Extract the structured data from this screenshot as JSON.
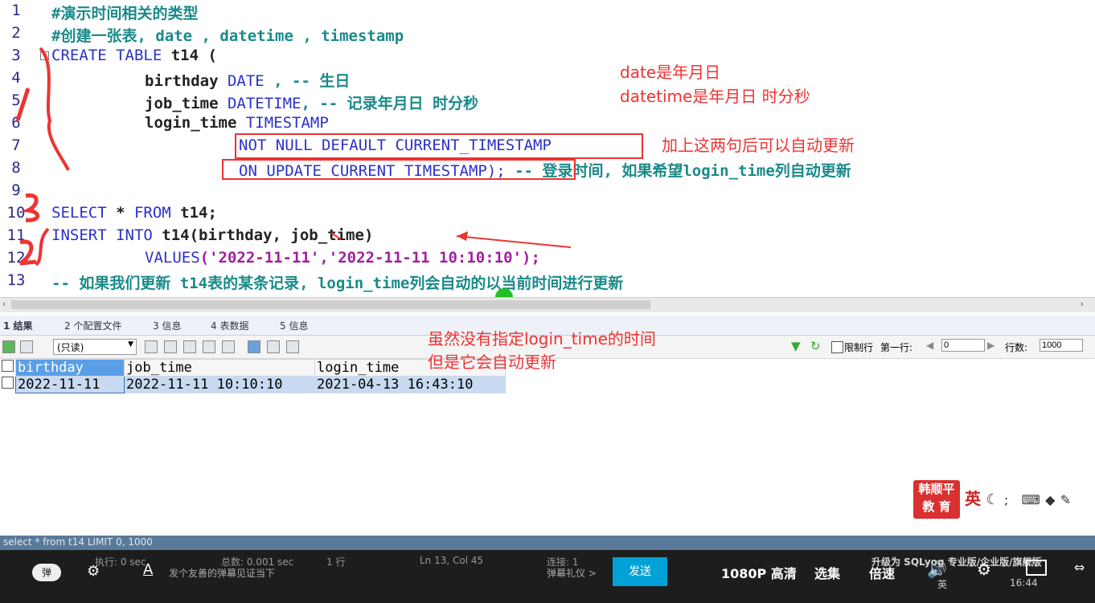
{
  "line_numbers": [
    "1",
    "2",
    "3",
    "4",
    "5",
    "6",
    "7",
    "8",
    "9",
    "10",
    "11",
    "12",
    "13"
  ],
  "code": {
    "l1": "#演示时间相关的类型",
    "l2": "#创建一张表, date , datetime , timestamp",
    "l3_kw": "CREATE TABLE",
    "l3_rest": " t14 (",
    "l4_id": "birthday",
    "l4_kw": "DATE",
    "l4_cm": " , -- 生日",
    "l5_id": "job_time",
    "l5_kw": "DATETIME",
    "l5_cm": ", -- 记录年月日 时分秒",
    "l6_id": "login_time",
    "l6_kw": "TIMESTAMP",
    "l7": "NOT NULL DEFAULT CURRENT_TIMESTAMP",
    "l8_kw": "ON UPDATE CURRENT_TIMESTAMP);",
    "l8_cm": " -- 登录时间, 如果希望login_time列自动更新",
    "l10_kw1": "SELECT",
    "l10_mid": " * ",
    "l10_kw2": "FROM",
    "l10_rest": " t14;",
    "l11_kw": "INSERT INTO",
    "l11_rest": " t14(birthday, job_time)",
    "l12_kw": "VALUES",
    "l12_str": "('2022-11-11','2022-11-11 10:10:10');",
    "l13": "-- 如果我们更新 t14表的某条记录, login_time列会自动的以当前时间进行更新"
  },
  "annotations": {
    "a1": "date是年月日",
    "a2": "datetime是年月日 时分秒",
    "a3": "加上这两句后可以自动更新",
    "a4": "虽然没有指定login_time的时间",
    "a5": "但是它会自动更新"
  },
  "result_tabs": [
    "1 结果",
    "2 个配置文件",
    "3 信息",
    "4 表数据",
    "5 信息"
  ],
  "toolbar": {
    "mode": "(只读)",
    "limit_label": "限制行",
    "first_row_label": "第一行:",
    "first_row_value": "0",
    "rows_label": "行数:",
    "rows_value": "1000"
  },
  "result_table": {
    "columns": [
      "birthday",
      "job_time",
      "login_time"
    ],
    "rows": [
      [
        "2022-11-11",
        "2022-11-11 10:10:10",
        "2021-04-13 16:43:10"
      ]
    ]
  },
  "logo": {
    "line1": "韩顺平",
    "line2": "教 育"
  },
  "ime": "英",
  "status": {
    "query": "select * from t14 LIMIT 0, 1000",
    "exec": "执行: 0 sec",
    "total": "总数: 0.001 sec",
    "rows": "1 行",
    "pos": "Ln 13, Col 45",
    "conn": "连接: 1",
    "promo": "升级为 SQLyog 专业版/企业版/旗舰版"
  },
  "player": {
    "danmaku": "弹",
    "placeholder": "发个友善的弹幕见证当下",
    "etiquette": "弹幕礼仪 >",
    "send": "发送",
    "quality": "1080P 高清",
    "episodes": "选集",
    "speed": "倍速",
    "time": "16:44",
    "ime": "英"
  }
}
